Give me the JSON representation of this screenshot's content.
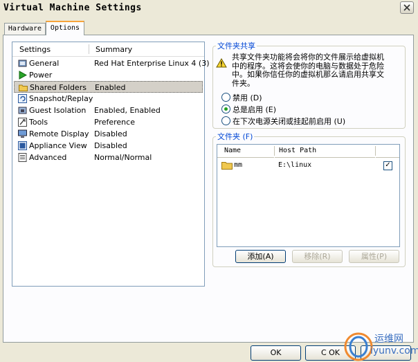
{
  "window": {
    "title": "Virtual Machine Settings"
  },
  "tabs": [
    {
      "label": "Hardware",
      "active": false
    },
    {
      "label": "Options",
      "active": true
    }
  ],
  "settings_list": {
    "columns": [
      "Settings",
      "Summary"
    ],
    "rows": [
      {
        "name": "General",
        "summary": "Red Hat Enterprise Linux 4 (3)",
        "icon": "general-icon",
        "selected": false
      },
      {
        "name": "Power",
        "summary": "",
        "icon": "power-play-icon",
        "selected": false
      },
      {
        "name": "Shared Folders",
        "summary": "Enabled",
        "icon": "folder-icon",
        "selected": true
      },
      {
        "name": "Snapshot/Replay",
        "summary": "",
        "icon": "snapshot-icon",
        "selected": false
      },
      {
        "name": "Guest Isolation",
        "summary": "Enabled, Enabled",
        "icon": "isolation-icon",
        "selected": false
      },
      {
        "name": "Tools",
        "summary": "Preference",
        "icon": "tools-icon",
        "selected": false
      },
      {
        "name": "Remote Display",
        "summary": "Disabled",
        "icon": "remote-display-icon",
        "selected": false
      },
      {
        "name": "Appliance View",
        "summary": "Disabled",
        "icon": "appliance-view-icon",
        "selected": false
      },
      {
        "name": "Advanced",
        "summary": "Normal/Normal",
        "icon": "advanced-icon",
        "selected": false
      }
    ]
  },
  "folder_sharing": {
    "group_title": "文件夹共享",
    "warning_line1": "共享文件夹功能将会将你的文件展示给虚拟机",
    "warning_line2": "中的程序。这将会使你的电脑与数据处于危险",
    "warning_line3": "中。如果你信任你的虚拟机那么请启用共享文",
    "warning_line4": "件夹。",
    "options": [
      {
        "label": "禁用 (D)",
        "selected": false
      },
      {
        "label": "总是启用 (E)",
        "selected": true
      },
      {
        "label": "在下次电源关闭或挂起前启用 (U)",
        "selected": false
      }
    ]
  },
  "folders": {
    "group_title": "文件夹 (F)",
    "columns": [
      "Name",
      "Host Path"
    ],
    "rows": [
      {
        "name": "mm",
        "host_path": "E:\\linux",
        "enabled": true
      }
    ],
    "buttons": {
      "add": "添加(A)",
      "remove": "移除(R)",
      "properties": "属性(P)"
    }
  },
  "footer": {
    "ok": "OK",
    "cancel": "C OK",
    "help": ""
  },
  "watermark": {
    "text": "运维网",
    "url": "iyunv.com"
  },
  "colors": {
    "accent_tab": "#f7a43a",
    "group_title": "#0046d5",
    "selection": "#d4d0c8"
  }
}
